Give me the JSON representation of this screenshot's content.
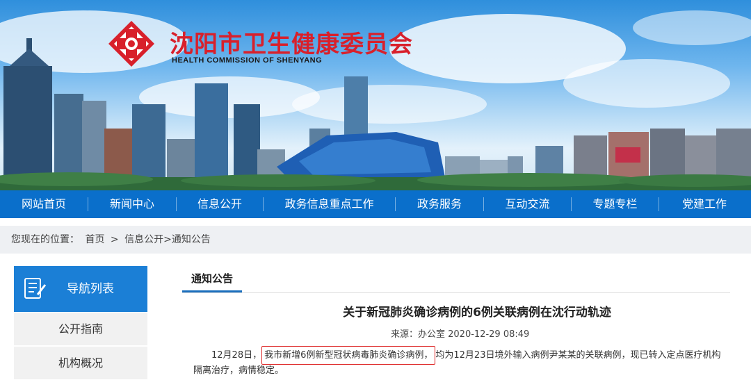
{
  "header": {
    "title_cn": "沈阳市卫生健康委员会",
    "title_en": "HEALTH COMMISSION OF SHENYANG"
  },
  "nav": {
    "items": [
      "网站首页",
      "新闻中心",
      "信息公开",
      "政务信息重点工作",
      "政务服务",
      "互动交流",
      "专题专栏",
      "党建工作"
    ]
  },
  "breadcrumb": {
    "prefix": "您现在的位置：",
    "home": "首页",
    "sep1": ">",
    "section": "信息公开",
    "sep2": ">",
    "current": "通知公告"
  },
  "sidebar": {
    "title": "导航列表",
    "items": [
      "公开指南",
      "机构概况"
    ]
  },
  "content": {
    "tab": "通知公告",
    "title": "关于新冠肺炎确诊病例的6例关联病例在沈行动轨迹",
    "meta": "来源：办公室 2020-12-29 08:49",
    "p1_start": "12月28日，",
    "p1_highlight": "我市新增6例新型冠状病毒肺炎确诊病例，",
    "p1_end": "均为12月23日境外输入病例尹某某的关联病例，现已转入定点医疗机构隔离治疗，病情稳定。"
  },
  "colors": {
    "nav_bg": "#0a6fcb",
    "brand_red": "#d8202b",
    "sidebar_head": "#1b7fd6"
  }
}
